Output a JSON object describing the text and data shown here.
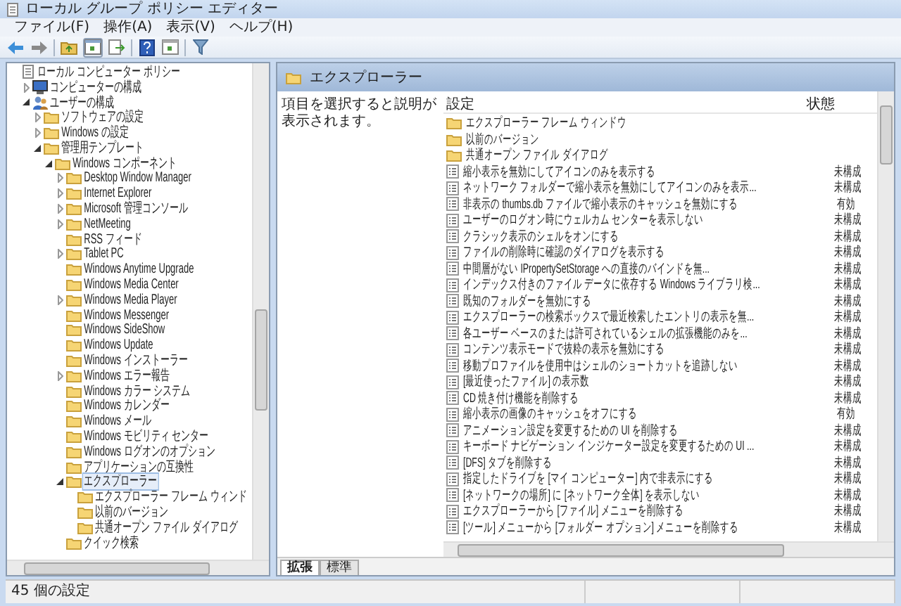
{
  "window": {
    "title": "ローカル グループ ポリシー エディター"
  },
  "menu": [
    "ファイル(F)",
    "操作(A)",
    "表示(V)",
    "ヘルプ(H)"
  ],
  "tree": [
    {
      "label": "ローカル コンピューター ポリシー",
      "kind": "policy",
      "selected": false,
      "children": [
        {
          "label": "コンピューターの構成",
          "kind": "computer",
          "expanded": false,
          "selected": false
        },
        {
          "label": "ユーザーの構成",
          "kind": "user",
          "expanded": true,
          "selected": false,
          "children": [
            {
              "label": "ソフトウェアの設定",
              "kind": "folder",
              "expanded": false,
              "selected": false
            },
            {
              "label": "Windows の設定",
              "kind": "folder",
              "expanded": false,
              "selected": false
            },
            {
              "label": "管理用テンプレート",
              "kind": "folder",
              "expanded": true,
              "selected": false,
              "children": [
                {
                  "label": "Windows コンポーネント",
                  "kind": "folder",
                  "expanded": true,
                  "selected": false,
                  "children": [
                    {
                      "label": "Desktop Window Manager",
                      "kind": "folder",
                      "expanded": false,
                      "selected": false
                    },
                    {
                      "label": "Internet Explorer",
                      "kind": "folder",
                      "expanded": false,
                      "selected": false
                    },
                    {
                      "label": "Microsoft 管理コンソール",
                      "kind": "folder",
                      "expanded": false,
                      "selected": false
                    },
                    {
                      "label": "NetMeeting",
                      "kind": "folder",
                      "expanded": false,
                      "selected": false
                    },
                    {
                      "label": "RSS フィード",
                      "kind": "folder",
                      "selected": false
                    },
                    {
                      "label": "Tablet PC",
                      "kind": "folder",
                      "expanded": false,
                      "selected": false
                    },
                    {
                      "label": "Windows Anytime Upgrade",
                      "kind": "folder",
                      "selected": false
                    },
                    {
                      "label": "Windows Media Center",
                      "kind": "folder",
                      "selected": false
                    },
                    {
                      "label": "Windows Media Player",
                      "kind": "folder",
                      "expanded": false,
                      "selected": false
                    },
                    {
                      "label": "Windows Messenger",
                      "kind": "folder",
                      "selected": false
                    },
                    {
                      "label": "Windows SideShow",
                      "kind": "folder",
                      "selected": false
                    },
                    {
                      "label": "Windows Update",
                      "kind": "folder",
                      "selected": false
                    },
                    {
                      "label": "Windows インストーラー",
                      "kind": "folder",
                      "selected": false
                    },
                    {
                      "label": "Windows エラー報告",
                      "kind": "folder",
                      "expanded": false,
                      "selected": false
                    },
                    {
                      "label": "Windows カラー システム",
                      "kind": "folder",
                      "selected": false
                    },
                    {
                      "label": "Windows カレンダー",
                      "kind": "folder",
                      "selected": false
                    },
                    {
                      "label": "Windows メール",
                      "kind": "folder",
                      "selected": false
                    },
                    {
                      "label": "Windows モビリティ センター",
                      "kind": "folder",
                      "selected": false
                    },
                    {
                      "label": "Windows ログオンのオプション",
                      "kind": "folder",
                      "selected": false
                    },
                    {
                      "label": "アプリケーションの互換性",
                      "kind": "folder",
                      "selected": false
                    },
                    {
                      "label": "エクスプローラー",
                      "kind": "folder",
                      "expanded": true,
                      "selected": true,
                      "children": [
                        {
                          "label": "エクスプローラー フレーム ウィンド",
                          "kind": "folder",
                          "selected": false
                        },
                        {
                          "label": "以前のバージョン",
                          "kind": "folder",
                          "selected": false
                        },
                        {
                          "label": "共通オープン ファイル ダイアログ",
                          "kind": "folder",
                          "selected": false
                        }
                      ]
                    },
                    {
                      "label": "クイック検索",
                      "kind": "folder",
                      "selected": false
                    }
                  ]
                }
              ]
            }
          ]
        }
      ]
    }
  ],
  "header": {
    "title": "エクスプローラー"
  },
  "description": "項目を選択すると説明が表示されます。",
  "columns": [
    "設定",
    "状態"
  ],
  "rows": [
    {
      "kind": "folder",
      "name": "エクスプローラー フレーム ウィンドウ"
    },
    {
      "kind": "folder",
      "name": "以前のバージョン"
    },
    {
      "kind": "folder",
      "name": "共通オープン ファイル ダイアログ"
    },
    {
      "kind": "setting",
      "name": "縮小表示を無効にしてアイコンのみを表示する",
      "state": "未構成"
    },
    {
      "kind": "setting",
      "name": "ネットワーク フォルダーで縮小表示を無効にしてアイコンのみを表示...",
      "state": "未構成"
    },
    {
      "kind": "setting",
      "name": "非表示の thumbs.db ファイルで縮小表示のキャッシュを無効にする",
      "state": "有効"
    },
    {
      "kind": "setting",
      "name": "ユーザーのログオン時にウェルカム センターを表示しない",
      "state": "未構成"
    },
    {
      "kind": "setting",
      "name": "クラシック表示のシェルをオンにする",
      "state": "未構成"
    },
    {
      "kind": "setting",
      "name": "ファイルの削除時に確認のダイアログを表示する",
      "state": "未構成"
    },
    {
      "kind": "setting",
      "name": "中間層がない IPropertySetStorage への直接のバインドを無...",
      "state": "未構成"
    },
    {
      "kind": "setting",
      "name": "インデックス付きのファイル データに依存する Windows ライブラリ検...",
      "state": "未構成"
    },
    {
      "kind": "setting",
      "name": "既知のフォルダーを無効にする",
      "state": "未構成"
    },
    {
      "kind": "setting",
      "name": "エクスプローラーの検索ボックスで最近検索したエントリの表示を無...",
      "state": "未構成"
    },
    {
      "kind": "setting",
      "name": "各ユーザー ベースのまたは許可されているシェルの拡張機能のみを...",
      "state": "未構成"
    },
    {
      "kind": "setting",
      "name": "コンテンツ表示モードで抜粋の表示を無効にする",
      "state": "未構成"
    },
    {
      "kind": "setting",
      "name": "移動プロファイルを使用中はシェルのショートカットを追跡しない",
      "state": "未構成"
    },
    {
      "kind": "setting",
      "name": "[最近使ったファイル] の表示数",
      "state": "未構成"
    },
    {
      "kind": "setting",
      "name": "CD 焼き付け機能を削除する",
      "state": "未構成"
    },
    {
      "kind": "setting",
      "name": "縮小表示の画像のキャッシュをオフにする",
      "state": "有効"
    },
    {
      "kind": "setting",
      "name": "アニメーション設定を変更するための UI を削除する",
      "state": "未構成"
    },
    {
      "kind": "setting",
      "name": "キーボード ナビゲーション インジケーター設定を変更するための UI ...",
      "state": "未構成"
    },
    {
      "kind": "setting",
      "name": "[DFS] タブを削除する",
      "state": "未構成"
    },
    {
      "kind": "setting",
      "name": "指定したドライブを [マイ コンピューター] 内で非表示にする",
      "state": "未構成"
    },
    {
      "kind": "setting",
      "name": "[ネットワークの場所] に [ネットワーク全体] を表示しない",
      "state": "未構成"
    },
    {
      "kind": "setting",
      "name": "エクスプローラーから [ファイル] メニューを削除する",
      "state": "未構成"
    },
    {
      "kind": "setting",
      "name": "[ツール] メニューから [フォルダー オプション] メニューを削除する",
      "state": "未構成"
    }
  ],
  "tabs": [
    {
      "label": "拡張",
      "selected": true
    },
    {
      "label": "標準",
      "selected": false
    }
  ],
  "status_bar": "45 個の設定"
}
